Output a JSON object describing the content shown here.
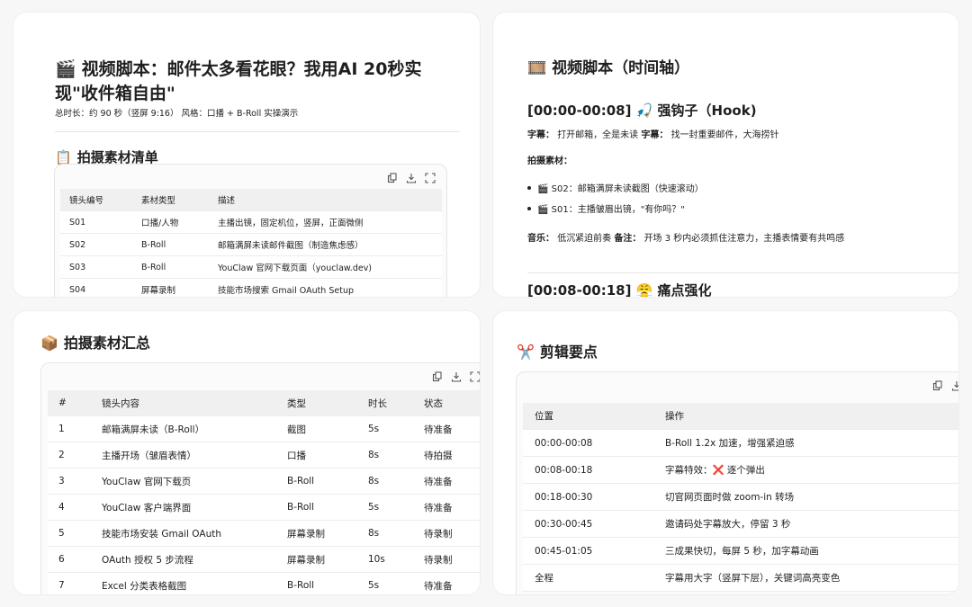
{
  "card_script": {
    "title_icon": "🎬",
    "title": "视频脚本：邮件太多看花眼？我用AI 20秒实现\"收件箱自由\"",
    "meta": "总时长：约 90 秒（竖屏 9:16） 风格：口播 + B-Roll 实操演示",
    "materials_icon": "📋",
    "materials_heading": "拍摄素材清单",
    "table": {
      "headers": [
        "镜头编号",
        "素材类型",
        "描述"
      ],
      "rows": [
        [
          "S01",
          "口播/人物",
          "主播出镜，固定机位，竖屏，正面微侧"
        ],
        [
          "S02",
          "B-Roll",
          "邮箱满屏未读邮件截图（制造焦虑感）"
        ],
        [
          "S03",
          "B-Roll",
          "YouClaw 官网下载页面（youclaw.dev)"
        ],
        [
          "S04",
          "屏幕录制",
          "技能市场搜索 Gmail OAuth Setup"
        ]
      ]
    }
  },
  "card_timeline": {
    "title_icon": "🎞️",
    "title": "视频脚本（时间轴）",
    "seg1_title": "[00:00-00:08] 🎣 强钩子（Hook)",
    "subtitle_label": "字幕：",
    "subtitle1_text": "打开邮箱，全是未读",
    "subtitle2_label": "字幕：",
    "subtitle2_text": "找一封重要邮件，大海捞针",
    "materials_label": "拍摄素材：",
    "bullet1": "🎬 S02：邮箱满屏未读截图（快速滚动）",
    "bullet2": "🎬 S01：主播皱眉出镜，\"有你吗？\"",
    "music_label": "音乐：",
    "music_text": "低沉紧迫前奏",
    "note_label": "备注：",
    "note_text": "开场 3 秒内必须抓住注意力，主播表情要有共鸣感",
    "seg2_title": "[00:08-00:18] 😤 痛点强化"
  },
  "card_summary": {
    "icon": "📦",
    "heading": "拍摄素材汇总",
    "table": {
      "headers": [
        "#",
        "镜头内容",
        "类型",
        "时长",
        "状态"
      ],
      "rows": [
        [
          "1",
          "邮箱满屏未读（B-Roll）",
          "截图",
          "5s",
          "待准备"
        ],
        [
          "2",
          "主播开场（皱眉表情）",
          "口播",
          "8s",
          "待拍摄"
        ],
        [
          "3",
          "YouClaw 官网下载页",
          "B-Roll",
          "8s",
          "待准备"
        ],
        [
          "4",
          "YouClaw 客户端界面",
          "B-Roll",
          "5s",
          "待准备"
        ],
        [
          "5",
          "技能市场安装 Gmail OAuth",
          "屏幕录制",
          "8s",
          "待录制"
        ],
        [
          "6",
          "OAuth 授权 5 步流程",
          "屏幕录制",
          "10s",
          "待录制"
        ],
        [
          "7",
          "Excel 分类表格截图",
          "B-Roll",
          "5s",
          "待准备"
        ]
      ]
    }
  },
  "card_edit": {
    "icon": "✂️",
    "heading": "剪辑要点",
    "table": {
      "headers": [
        "位置",
        "操作"
      ],
      "rows": [
        [
          "00:00-00:08",
          "B-Roll 1.2x 加速，增强紧迫感"
        ],
        [
          "00:08-00:18",
          "字幕特效：❌ 逐个弹出"
        ],
        [
          "00:18-00:30",
          "切官网页面时做 zoom-in 转场"
        ],
        [
          "00:30-00:45",
          "邀请码处字幕放大，停留 3 秒"
        ],
        [
          "00:45-01:05",
          "三成果快切，每屏 5 秒，加字幕动画"
        ],
        [
          "全程",
          "字幕用大字（竖屏下层），关键词高亮变色"
        ]
      ]
    }
  }
}
